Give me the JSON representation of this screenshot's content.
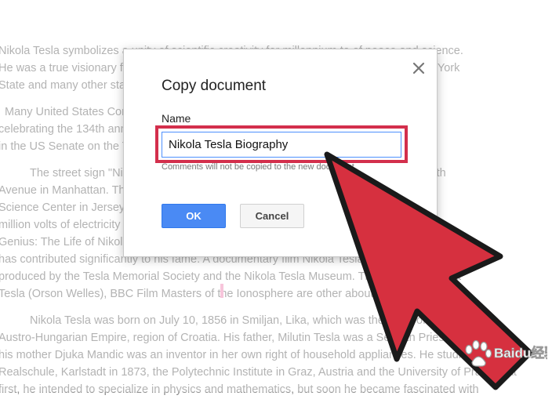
{
  "document": {
    "lines": [
      "Nikola Tesla symbolizes a unity of scientific creativity for millennium to of peace and science.",
      "He was a true visionary far ahead of his time in the field of scientific development. New York",
      "State and many other states in the United States celebrate July 10 as Tesla Day.",
      "Many United States Congressmen honored Nikola Tesla on his birthday, July 10, 1990",
      "celebrating the 134th anniversary. Representative of Tesla from Michigan spoke",
      "in the US Senate on the Tesla.",
      "The street sign \"Nikola Tesla Corner\" is located at the corner of 40th Street and 6th",
      "Avenue in Manhattan. The Nikola Tesla statue at Niagara Falls Museum. The Liberty",
      "Science Center in Jersey City has a Tesla Coil creating a",
      "million volts of electricity in the Tesla. The biography Nikola Tesla :Prodigal",
      "Genius: The Life of Nikola Tesla by John J. O'Neill and the Man Out of Time",
      "has contributed significantly to his fame. A documentary film Nikola Tesla the World,",
      "produced by the Tesla Memorial Society and the Nikola Tesla Museum. The Secret of Nikola",
      "Tesla (Orson Welles), BBC Film Masters of the Ionosphere are other about that genius.",
      "Nikola Tesla was born on July 10, 1856 in Smiljan, Lika, which was then part of",
      "Austro-Hungarian Empire, region of Croatia. His father, Milutin Tesla was a Serbian Priest and",
      "his mother Djuka Mandic was an inventor in her own right of household appliances. He studied at the",
      "Realschule, Karlstadt in 1873, the Polytechnic Institute in Graz, Austria and the University of Prague. At",
      "first, he intended to specialize in physics and mathematics, but soon he became fascinated with"
    ]
  },
  "dialog": {
    "title": "Copy document",
    "close_symbol": "✕",
    "name_label": "Name",
    "name_value": "Nikola Tesla Biography",
    "note": "Comments will not be copied to the new document.",
    "ok_label": "OK",
    "cancel_label": "Cancel"
  },
  "colors": {
    "highlight": "#d32f4c",
    "arrow_fill": "#d6303f",
    "arrow_outline": "#1a1a1a",
    "ok_button": "#4a8af4"
  },
  "watermark": {
    "text": "Baidu经验",
    "icon": "paw-icon"
  }
}
